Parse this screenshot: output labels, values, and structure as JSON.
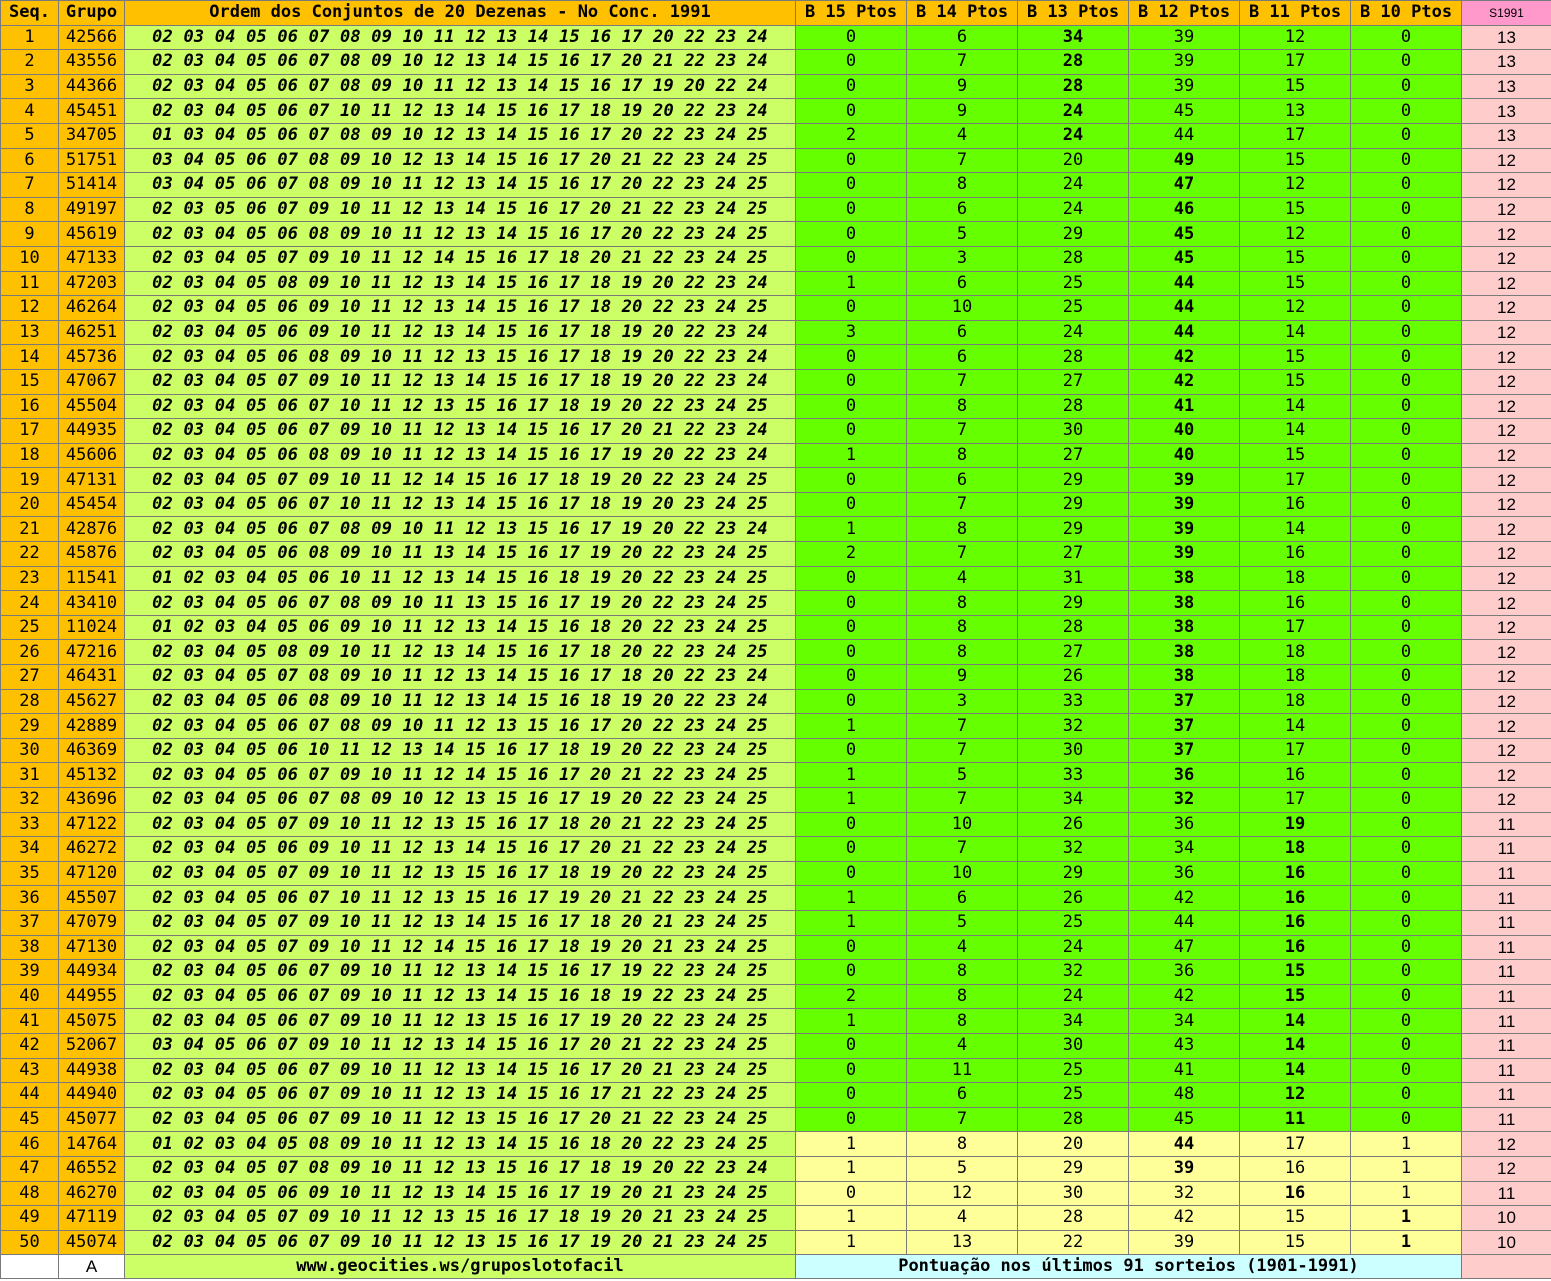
{
  "headers": {
    "seq": "Seq.",
    "grupo": "Grupo",
    "ordem": "Ordem dos Conjuntos de 20 Dezenas - No Conc. 1991",
    "b15": "B 15 Ptos",
    "b14": "B 14 Ptos",
    "b13": "B 13 Ptos",
    "b12": "B 12 Ptos",
    "b11": "B 11 Ptos",
    "b10": "B 10 Ptos",
    "side": "S1991"
  },
  "colors": {
    "header": "#ffc000",
    "numbers_bg": "#ccff66",
    "points_green": "#66ff00",
    "points_yellow": "#ffff99",
    "side_bg": "#ffcccc",
    "highlight": "#ff0000",
    "link": "#0000ff"
  },
  "rows": [
    {
      "seq": "1",
      "grupo": "42566",
      "nums": "02 03 04 05 06 07 08 09 10 11 12 13 14 15 16 17 20 22 23 24",
      "b15": "0",
      "b14": "6",
      "b13": "34",
      "b12": "39",
      "b11": "12",
      "b10": "0",
      "side": "13",
      "hl": "b13"
    },
    {
      "seq": "2",
      "grupo": "43556",
      "nums": "02 03 04 05 06 07 08 09 10 12 13 14 15 16 17 20 21 22 23 24",
      "b15": "0",
      "b14": "7",
      "b13": "28",
      "b12": "39",
      "b11": "17",
      "b10": "0",
      "side": "13",
      "hl": "b13"
    },
    {
      "seq": "3",
      "grupo": "44366",
      "nums": "02 03 04 05 06 07 08 09 10 11 12 13 14 15 16 17 19 20 22 24",
      "b15": "0",
      "b14": "9",
      "b13": "28",
      "b12": "39",
      "b11": "15",
      "b10": "0",
      "side": "13",
      "hl": "b13"
    },
    {
      "seq": "4",
      "grupo": "45451",
      "nums": "02 03 04 05 06 07 10 11 12 13 14 15 16 17 18 19 20 22 23 24",
      "b15": "0",
      "b14": "9",
      "b13": "24",
      "b12": "45",
      "b11": "13",
      "b10": "0",
      "side": "13",
      "hl": "b13"
    },
    {
      "seq": "5",
      "grupo": "34705",
      "nums": "01 03 04 05 06 07 08 09 10 12 13 14 15 16 17 20 22 23 24 25",
      "b15": "2",
      "b14": "4",
      "b13": "24",
      "b12": "44",
      "b11": "17",
      "b10": "0",
      "side": "13",
      "hl": "b13"
    },
    {
      "seq": "6",
      "grupo": "51751",
      "nums": "03 04 05 06 07 08 09 10 12 13 14 15 16 17 20 21 22 23 24 25",
      "b15": "0",
      "b14": "7",
      "b13": "20",
      "b12": "49",
      "b11": "15",
      "b10": "0",
      "side": "12",
      "hl": "b12"
    },
    {
      "seq": "7",
      "grupo": "51414",
      "nums": "03 04 05 06 07 08 09 10 11 12 13 14 15 16 17 20 22 23 24 25",
      "b15": "0",
      "b14": "8",
      "b13": "24",
      "b12": "47",
      "b11": "12",
      "b10": "0",
      "side": "12",
      "hl": "b12"
    },
    {
      "seq": "8",
      "grupo": "49197",
      "nums": "02 03 05 06 07 09 10 11 12 13 14 15 16 17 20 21 22 23 24 25",
      "b15": "0",
      "b14": "6",
      "b13": "24",
      "b12": "46",
      "b11": "15",
      "b10": "0",
      "side": "12",
      "hl": "b12"
    },
    {
      "seq": "9",
      "grupo": "45619",
      "nums": "02 03 04 05 06 08 09 10 11 12 13 14 15 16 17 20 22 23 24 25",
      "b15": "0",
      "b14": "5",
      "b13": "29",
      "b12": "45",
      "b11": "12",
      "b10": "0",
      "side": "12",
      "hl": "b12"
    },
    {
      "seq": "10",
      "grupo": "47133",
      "nums": "02 03 04 05 07 09 10 11 12 14 15 16 17 18 20 21 22 23 24 25",
      "b15": "0",
      "b14": "3",
      "b13": "28",
      "b12": "45",
      "b11": "15",
      "b10": "0",
      "side": "12",
      "hl": "b12"
    },
    {
      "seq": "11",
      "grupo": "47203",
      "nums": "02 03 04 05 08 09 10 11 12 13 14 15 16 17 18 19 20 22 23 24",
      "b15": "1",
      "b14": "6",
      "b13": "25",
      "b12": "44",
      "b11": "15",
      "b10": "0",
      "side": "12",
      "hl": "b12"
    },
    {
      "seq": "12",
      "grupo": "46264",
      "nums": "02 03 04 05 06 09 10 11 12 13 14 15 16 17 18 20 22 23 24 25",
      "b15": "0",
      "b14": "10",
      "b13": "25",
      "b12": "44",
      "b11": "12",
      "b10": "0",
      "side": "12",
      "hl": "b12"
    },
    {
      "seq": "13",
      "grupo": "46251",
      "nums": "02 03 04 05 06 09 10 11 12 13 14 15 16 17 18 19 20 22 23 24",
      "b15": "3",
      "b14": "6",
      "b13": "24",
      "b12": "44",
      "b11": "14",
      "b10": "0",
      "side": "12",
      "hl": "b12"
    },
    {
      "seq": "14",
      "grupo": "45736",
      "nums": "02 03 04 05 06 08 09 10 11 12 13 15 16 17 18 19 20 22 23 24",
      "b15": "0",
      "b14": "6",
      "b13": "28",
      "b12": "42",
      "b11": "15",
      "b10": "0",
      "side": "12",
      "hl": "b12"
    },
    {
      "seq": "15",
      "grupo": "47067",
      "nums": "02 03 04 05 07 09 10 11 12 13 14 15 16 17 18 19 20 22 23 24",
      "b15": "0",
      "b14": "7",
      "b13": "27",
      "b12": "42",
      "b11": "15",
      "b10": "0",
      "side": "12",
      "hl": "b12"
    },
    {
      "seq": "16",
      "grupo": "45504",
      "nums": "02 03 04 05 06 07 10 11 12 13 15 16 17 18 19 20 22 23 24 25",
      "b15": "0",
      "b14": "8",
      "b13": "28",
      "b12": "41",
      "b11": "14",
      "b10": "0",
      "side": "12",
      "hl": "b12"
    },
    {
      "seq": "17",
      "grupo": "44935",
      "nums": "02 03 04 05 06 07 09 10 11 12 13 14 15 16 17 20 21 22 23 24",
      "b15": "0",
      "b14": "7",
      "b13": "30",
      "b12": "40",
      "b11": "14",
      "b10": "0",
      "side": "12",
      "hl": "b12"
    },
    {
      "seq": "18",
      "grupo": "45606",
      "nums": "02 03 04 05 06 08 09 10 11 12 13 14 15 16 17 19 20 22 23 24",
      "b15": "1",
      "b14": "8",
      "b13": "27",
      "b12": "40",
      "b11": "15",
      "b10": "0",
      "side": "12",
      "hl": "b12"
    },
    {
      "seq": "19",
      "grupo": "47131",
      "nums": "02 03 04 05 07 09 10 11 12 14 15 16 17 18 19 20 22 23 24 25",
      "b15": "0",
      "b14": "6",
      "b13": "29",
      "b12": "39",
      "b11": "17",
      "b10": "0",
      "side": "12",
      "hl": "b12"
    },
    {
      "seq": "20",
      "grupo": "45454",
      "nums": "02 03 04 05 06 07 10 11 12 13 14 15 16 17 18 19 20 23 24 25",
      "b15": "0",
      "b14": "7",
      "b13": "29",
      "b12": "39",
      "b11": "16",
      "b10": "0",
      "side": "12",
      "hl": "b12"
    },
    {
      "seq": "21",
      "grupo": "42876",
      "nums": "02 03 04 05 06 07 08 09 10 11 12 13 15 16 17 19 20 22 23 24",
      "b15": "1",
      "b14": "8",
      "b13": "29",
      "b12": "39",
      "b11": "14",
      "b10": "0",
      "side": "12",
      "hl": "b12"
    },
    {
      "seq": "22",
      "grupo": "45876",
      "nums": "02 03 04 05 06 08 09 10 11 13 14 15 16 17 19 20 22 23 24 25",
      "b15": "2",
      "b14": "7",
      "b13": "27",
      "b12": "39",
      "b11": "16",
      "b10": "0",
      "side": "12",
      "hl": "b12"
    },
    {
      "seq": "23",
      "grupo": "11541",
      "nums": "01 02 03 04 05 06 10 11 12 13 14 15 16 18 19 20 22 23 24 25",
      "b15": "0",
      "b14": "4",
      "b13": "31",
      "b12": "38",
      "b11": "18",
      "b10": "0",
      "side": "12",
      "hl": "b12"
    },
    {
      "seq": "24",
      "grupo": "43410",
      "nums": "02 03 04 05 06 07 08 09 10 11 13 15 16 17 19 20 22 23 24 25",
      "b15": "0",
      "b14": "8",
      "b13": "29",
      "b12": "38",
      "b11": "16",
      "b10": "0",
      "side": "12",
      "hl": "b12"
    },
    {
      "seq": "25",
      "grupo": "11024",
      "nums": "01 02 03 04 05 06 09 10 11 12 13 14 15 16 18 20 22 23 24 25",
      "b15": "0",
      "b14": "8",
      "b13": "28",
      "b12": "38",
      "b11": "17",
      "b10": "0",
      "side": "12",
      "hl": "b12"
    },
    {
      "seq": "26",
      "grupo": "47216",
      "nums": "02 03 04 05 08 09 10 11 12 13 14 15 16 17 18 20 22 23 24 25",
      "b15": "0",
      "b14": "8",
      "b13": "27",
      "b12": "38",
      "b11": "18",
      "b10": "0",
      "side": "12",
      "hl": "b12"
    },
    {
      "seq": "27",
      "grupo": "46431",
      "nums": "02 03 04 05 07 08 09 10 11 12 13 14 15 16 17 18 20 22 23 24",
      "b15": "0",
      "b14": "9",
      "b13": "26",
      "b12": "38",
      "b11": "18",
      "b10": "0",
      "side": "12",
      "hl": "b12"
    },
    {
      "seq": "28",
      "grupo": "45627",
      "nums": "02 03 04 05 06 08 09 10 11 12 13 14 15 16 18 19 20 22 23 24",
      "b15": "0",
      "b14": "3",
      "b13": "33",
      "b12": "37",
      "b11": "18",
      "b10": "0",
      "side": "12",
      "hl": "b12"
    },
    {
      "seq": "29",
      "grupo": "42889",
      "nums": "02 03 04 05 06 07 08 09 10 11 12 13 15 16 17 20 22 23 24 25",
      "b15": "1",
      "b14": "7",
      "b13": "32",
      "b12": "37",
      "b11": "14",
      "b10": "0",
      "side": "12",
      "hl": "b12"
    },
    {
      "seq": "30",
      "grupo": "46369",
      "nums": "02 03 04 05 06 10 11 12 13 14 15 16 17 18 19 20 22 23 24 25",
      "b15": "0",
      "b14": "7",
      "b13": "30",
      "b12": "37",
      "b11": "17",
      "b10": "0",
      "side": "12",
      "hl": "b12"
    },
    {
      "seq": "31",
      "grupo": "45132",
      "nums": "02 03 04 05 06 07 09 10 11 12 14 15 16 17 20 21 22 23 24 25",
      "b15": "1",
      "b14": "5",
      "b13": "33",
      "b12": "36",
      "b11": "16",
      "b10": "0",
      "side": "12",
      "hl": "b12"
    },
    {
      "seq": "32",
      "grupo": "43696",
      "nums": "02 03 04 05 06 07 08 09 10 12 13 15 16 17 19 20 22 23 24 25",
      "b15": "1",
      "b14": "7",
      "b13": "34",
      "b12": "32",
      "b11": "17",
      "b10": "0",
      "side": "12",
      "hl": "b12"
    },
    {
      "seq": "33",
      "grupo": "47122",
      "nums": "02 03 04 05 07 09 10 11 12 13 15 16 17 18 20 21 22 23 24 25",
      "b15": "0",
      "b14": "10",
      "b13": "26",
      "b12": "36",
      "b11": "19",
      "b10": "0",
      "side": "11",
      "hl": "b11"
    },
    {
      "seq": "34",
      "grupo": "46272",
      "nums": "02 03 04 05 06 09 10 11 12 13 14 15 16 17 20 21 22 23 24 25",
      "b15": "0",
      "b14": "7",
      "b13": "32",
      "b12": "34",
      "b11": "18",
      "b10": "0",
      "side": "11",
      "hl": "b11"
    },
    {
      "seq": "35",
      "grupo": "47120",
      "nums": "02 03 04 05 07 09 10 11 12 13 15 16 17 18 19 20 22 23 24 25",
      "b15": "0",
      "b14": "10",
      "b13": "29",
      "b12": "36",
      "b11": "16",
      "b10": "0",
      "side": "11",
      "hl": "b11"
    },
    {
      "seq": "36",
      "grupo": "45507",
      "nums": "02 03 04 05 06 07 10 11 12 13 15 16 17 19 20 21 22 23 24 25",
      "b15": "1",
      "b14": "6",
      "b13": "26",
      "b12": "42",
      "b11": "16",
      "b10": "0",
      "side": "11",
      "hl": "b11"
    },
    {
      "seq": "37",
      "grupo": "47079",
      "nums": "02 03 04 05 07 09 10 11 12 13 14 15 16 17 18 20 21 23 24 25",
      "b15": "1",
      "b14": "5",
      "b13": "25",
      "b12": "44",
      "b11": "16",
      "b10": "0",
      "side": "11",
      "hl": "b11"
    },
    {
      "seq": "38",
      "grupo": "47130",
      "nums": "02 03 04 05 07 09 10 11 12 14 15 16 17 18 19 20 21 23 24 25",
      "b15": "0",
      "b14": "4",
      "b13": "24",
      "b12": "47",
      "b11": "16",
      "b10": "0",
      "side": "11",
      "hl": "b11"
    },
    {
      "seq": "39",
      "grupo": "44934",
      "nums": "02 03 04 05 06 07 09 10 11 12 13 14 15 16 17 19 22 23 24 25",
      "b15": "0",
      "b14": "8",
      "b13": "32",
      "b12": "36",
      "b11": "15",
      "b10": "0",
      "side": "11",
      "hl": "b11"
    },
    {
      "seq": "40",
      "grupo": "44955",
      "nums": "02 03 04 05 06 07 09 10 11 12 13 14 15 16 18 19 22 23 24 25",
      "b15": "2",
      "b14": "8",
      "b13": "24",
      "b12": "42",
      "b11": "15",
      "b10": "0",
      "side": "11",
      "hl": "b11"
    },
    {
      "seq": "41",
      "grupo": "45075",
      "nums": "02 03 04 05 06 07 09 10 11 12 13 15 16 17 19 20 22 23 24 25",
      "b15": "1",
      "b14": "8",
      "b13": "34",
      "b12": "34",
      "b11": "14",
      "b10": "0",
      "side": "11",
      "hl": "b11"
    },
    {
      "seq": "42",
      "grupo": "52067",
      "nums": "03 04 05 06 07 09 10 11 12 13 14 15 16 17 20 21 22 23 24 25",
      "b15": "0",
      "b14": "4",
      "b13": "30",
      "b12": "43",
      "b11": "14",
      "b10": "0",
      "side": "11",
      "hl": "b11"
    },
    {
      "seq": "43",
      "grupo": "44938",
      "nums": "02 03 04 05 06 07 09 10 11 12 13 14 15 16 17 20 21 23 24 25",
      "b15": "0",
      "b14": "11",
      "b13": "25",
      "b12": "41",
      "b11": "14",
      "b10": "0",
      "side": "11",
      "hl": "b11"
    },
    {
      "seq": "44",
      "grupo": "44940",
      "nums": "02 03 04 05 06 07 09 10 11 12 13 14 15 16 17 21 22 23 24 25",
      "b15": "0",
      "b14": "6",
      "b13": "25",
      "b12": "48",
      "b11": "12",
      "b10": "0",
      "side": "11",
      "hl": "b11"
    },
    {
      "seq": "45",
      "grupo": "45077",
      "nums": "02 03 04 05 06 07 09 10 11 12 13 15 16 17 20 21 22 23 24 25",
      "b15": "0",
      "b14": "7",
      "b13": "28",
      "b12": "45",
      "b11": "11",
      "b10": "0",
      "side": "11",
      "hl": "b11"
    },
    {
      "seq": "46",
      "grupo": "14764",
      "nums": "01 02 03 04 05 08 09 10 11 12 13 14 15 16 18 20 22 23 24 25",
      "b15": "1",
      "b14": "8",
      "b13": "20",
      "b12": "44",
      "b11": "17",
      "b10": "1",
      "side": "12",
      "hl": "b12",
      "yellow": true
    },
    {
      "seq": "47",
      "grupo": "46552",
      "nums": "02 03 04 05 07 08 09 10 11 12 13 15 16 17 18 19 20 22 23 24",
      "b15": "1",
      "b14": "5",
      "b13": "29",
      "b12": "39",
      "b11": "16",
      "b10": "1",
      "side": "12",
      "hl": "b12",
      "yellow": true
    },
    {
      "seq": "48",
      "grupo": "46270",
      "nums": "02 03 04 05 06 09 10 11 12 13 14 15 16 17 19 20 21 23 24 25",
      "b15": "0",
      "b14": "12",
      "b13": "30",
      "b12": "32",
      "b11": "16",
      "b10": "1",
      "side": "11",
      "hl": "b11",
      "yellow": true
    },
    {
      "seq": "49",
      "grupo": "47119",
      "nums": "02 03 04 05 07 09 10 11 12 13 15 16 17 18 19 20 21 23 24 25",
      "b15": "1",
      "b14": "4",
      "b13": "28",
      "b12": "42",
      "b11": "15",
      "b10": "1",
      "side": "10",
      "hl": "b10",
      "yellow": true
    },
    {
      "seq": "50",
      "grupo": "45074",
      "nums": "02 03 04 05 06 07 09 10 11 12 13 15 16 17 19 20 21 23 24 25",
      "b15": "1",
      "b14": "13",
      "b13": "22",
      "b12": "39",
      "b11": "15",
      "b10": "1",
      "side": "10",
      "hl": "b10",
      "yellow": true
    }
  ],
  "footer": {
    "col_a": "A",
    "url": "www.geocities.ws/gruposlotofacil",
    "note": "Pontuação nos últimos 91 sorteios (1901-1991)"
  }
}
